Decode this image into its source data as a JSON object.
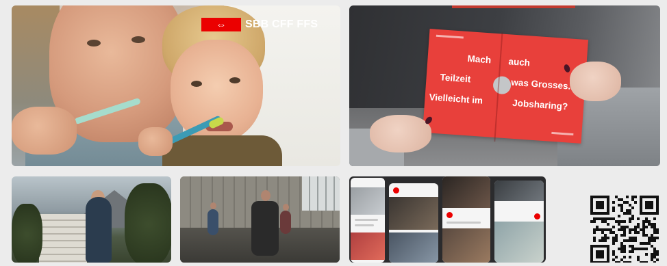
{
  "brand": {
    "logo_mark": "⇔",
    "wordmark": "SBB CFF FFS",
    "color": "#eb0000"
  },
  "tiles": {
    "family": {
      "icon": "photo-family-brushing-teeth"
    },
    "puzzle_card": {
      "lines_left": [
        "Mach",
        "Teilzeit",
        "Vielleicht im"
      ],
      "lines_right": [
        "auch",
        "was Grosses.",
        "Jobsharing?"
      ],
      "card_color": "#e8403b"
    },
    "hiker": {
      "icon": "photo-hiker-mountains"
    },
    "gym": {
      "icon": "photo-gym-volleyball"
    },
    "phones": {
      "icon": "social-media-phone-collage"
    }
  },
  "qr_code": {
    "icon": "qr-code-icon"
  }
}
